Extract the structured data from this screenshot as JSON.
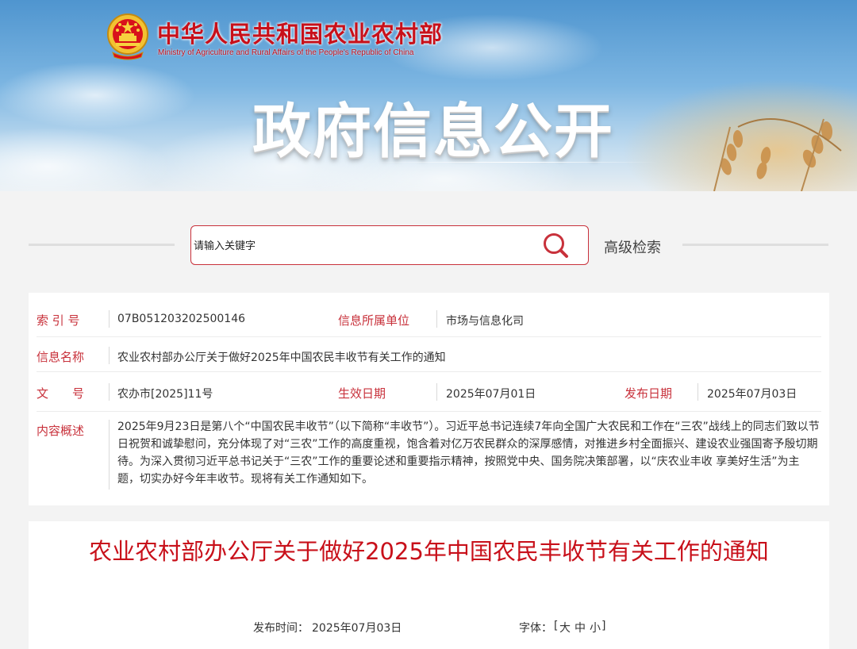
{
  "header": {
    "ministry_cn": "中华人民共和国农业农村部",
    "ministry_en": "Ministry of Agriculture and Rural Affairs of the People's Republic of China",
    "banner_title": "政府信息公开",
    "emblem_icon": "national-emblem-icon"
  },
  "search": {
    "placeholder": "请输入关键字",
    "icon": "search-icon",
    "advanced_label": "高级检索"
  },
  "info": {
    "index_label": "索 引 号",
    "index_value": "07B051203202500146",
    "unit_label": "信息所属单位",
    "unit_value": "市场与信息化司",
    "name_label": "信息名称",
    "name_value": "农业农村部办公厅关于做好2025年中国农民丰收节有关工作的通知",
    "doc_label": "文　　号",
    "doc_value": "农办市[2025]11号",
    "effective_label": "生效日期",
    "effective_value": "2025年07月01日",
    "publish_label": "发布日期",
    "publish_value": "2025年07月03日",
    "summary_label": "内容概述",
    "summary_value": "2025年9月23日是第八个“中国农民丰收节”（以下简称“丰收节”）。习近平总书记连续7年向全国广大农民和工作在“三农”战线上的同志们致以节日祝贺和诚挚慰问，充分体现了对“三农”工作的高度重视，饱含着对亿万农民群众的深厚感情，对推进乡村全面振兴、建设农业强国寄予殷切期待。为深入贯彻习近平总书记关于“三农”工作的重要论述和重要指示精神，按照党中央、国务院决策部署，以“庆农业丰收 享美好生活”为主题，切实办好今年丰收节。现将有关工作通知如下。"
  },
  "article": {
    "title": "农业农村部办公厅关于做好2025年中国农民丰收节有关工作的通知",
    "publish_time_label": "发布时间：",
    "publish_time": "2025年07月03日",
    "font_label": "字体：",
    "bracket_open": "[",
    "font_large": "大",
    "font_medium": "中",
    "font_small": "小",
    "bracket_close": "]"
  },
  "colors": {
    "accent": "#c8313b",
    "title_red": "#c8101a",
    "page_bg": "#f3f3f3"
  }
}
